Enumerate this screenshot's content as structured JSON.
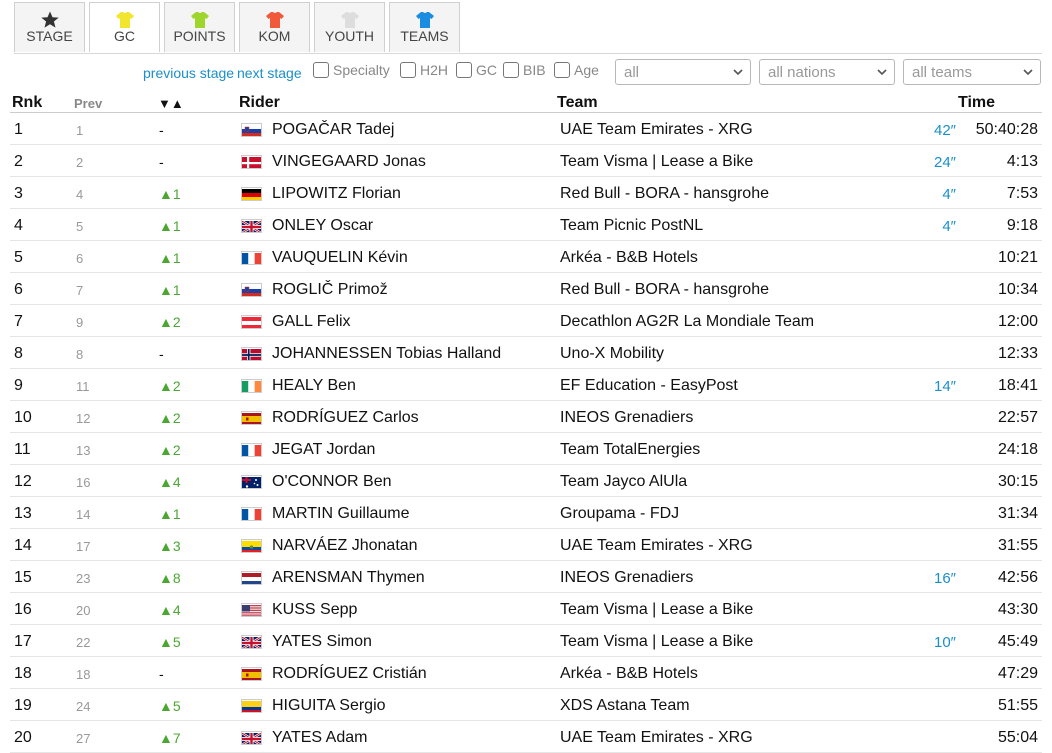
{
  "tabs": [
    {
      "label": "STAGE",
      "icon": "star-icon",
      "color": "#333333",
      "active": false
    },
    {
      "label": "GC",
      "icon": "jersey-icon",
      "color": "#f2e52e",
      "active": true
    },
    {
      "label": "POINTS",
      "icon": "jersey-icon",
      "color": "#9fd62c",
      "active": false
    },
    {
      "label": "KOM",
      "icon": "jersey-icon",
      "color": "#f05a3a",
      "active": false
    },
    {
      "label": "YOUTH",
      "icon": "jersey-icon",
      "color": "#dddddd",
      "active": false
    },
    {
      "label": "TEAMS",
      "icon": "jersey-icon",
      "color": "#1a8de0",
      "active": false
    }
  ],
  "filters": {
    "previous_stage": "previous stage",
    "next_stage": "next stage",
    "specialty": "Specialty",
    "h2h": "H2H",
    "gc": "GC",
    "bib": "BIB",
    "age": "Age",
    "select_all": "all",
    "select_nations": "all nations",
    "select_teams": "all teams"
  },
  "headers": {
    "rnk": "Rnk",
    "prev": "Prev",
    "change": "▼▲",
    "rider": "Rider",
    "team": "Team",
    "time": "Time"
  },
  "rows": [
    {
      "rnk": "1",
      "prev": "1",
      "chg": "-",
      "flag": "SI",
      "rider": "POGAČAR Tadej",
      "team": "UAE Team Emirates - XRG",
      "bonus": "42″",
      "time": "50:40:28"
    },
    {
      "rnk": "2",
      "prev": "2",
      "chg": "-",
      "flag": "DK",
      "rider": "VINGEGAARD Jonas",
      "team": "Team Visma | Lease a Bike",
      "bonus": "24″",
      "time": "4:13"
    },
    {
      "rnk": "3",
      "prev": "4",
      "chg": "▲1",
      "flag": "DE",
      "rider": "LIPOWITZ Florian",
      "team": "Red Bull - BORA - hansgrohe",
      "bonus": "4″",
      "time": "7:53"
    },
    {
      "rnk": "4",
      "prev": "5",
      "chg": "▲1",
      "flag": "GB",
      "rider": "ONLEY Oscar",
      "team": "Team Picnic PostNL",
      "bonus": "4″",
      "time": "9:18"
    },
    {
      "rnk": "5",
      "prev": "6",
      "chg": "▲1",
      "flag": "FR",
      "rider": "VAUQUELIN Kévin",
      "team": "Arkéa - B&B Hotels",
      "bonus": "",
      "time": "10:21"
    },
    {
      "rnk": "6",
      "prev": "7",
      "chg": "▲1",
      "flag": "SI",
      "rider": "ROGLIČ Primož",
      "team": "Red Bull - BORA - hansgrohe",
      "bonus": "",
      "time": "10:34"
    },
    {
      "rnk": "7",
      "prev": "9",
      "chg": "▲2",
      "flag": "AT",
      "rider": "GALL Felix",
      "team": "Decathlon AG2R La Mondiale Team",
      "bonus": "",
      "time": "12:00"
    },
    {
      "rnk": "8",
      "prev": "8",
      "chg": "-",
      "flag": "NO",
      "rider": "JOHANNESSEN Tobias Halland",
      "team": "Uno-X Mobility",
      "bonus": "",
      "time": "12:33"
    },
    {
      "rnk": "9",
      "prev": "11",
      "chg": "▲2",
      "flag": "IE",
      "rider": "HEALY Ben",
      "team": "EF Education - EasyPost",
      "bonus": "14″",
      "time": "18:41"
    },
    {
      "rnk": "10",
      "prev": "12",
      "chg": "▲2",
      "flag": "ES",
      "rider": "RODRÍGUEZ Carlos",
      "team": "INEOS Grenadiers",
      "bonus": "",
      "time": "22:57"
    },
    {
      "rnk": "11",
      "prev": "13",
      "chg": "▲2",
      "flag": "FR",
      "rider": "JEGAT Jordan",
      "team": "Team TotalEnergies",
      "bonus": "",
      "time": "24:18"
    },
    {
      "rnk": "12",
      "prev": "16",
      "chg": "▲4",
      "flag": "AU",
      "rider": "O'CONNOR Ben",
      "team": "Team Jayco AlUla",
      "bonus": "",
      "time": "30:15"
    },
    {
      "rnk": "13",
      "prev": "14",
      "chg": "▲1",
      "flag": "FR",
      "rider": "MARTIN Guillaume",
      "team": "Groupama - FDJ",
      "bonus": "",
      "time": "31:34"
    },
    {
      "rnk": "14",
      "prev": "17",
      "chg": "▲3",
      "flag": "EC",
      "rider": "NARVÁEZ Jhonatan",
      "team": "UAE Team Emirates - XRG",
      "bonus": "",
      "time": "31:55"
    },
    {
      "rnk": "15",
      "prev": "23",
      "chg": "▲8",
      "flag": "NL",
      "rider": "ARENSMAN Thymen",
      "team": "INEOS Grenadiers",
      "bonus": "16″",
      "time": "42:56"
    },
    {
      "rnk": "16",
      "prev": "20",
      "chg": "▲4",
      "flag": "US",
      "rider": "KUSS Sepp",
      "team": "Team Visma | Lease a Bike",
      "bonus": "",
      "time": "43:30"
    },
    {
      "rnk": "17",
      "prev": "22",
      "chg": "▲5",
      "flag": "GB",
      "rider": "YATES Simon",
      "team": "Team Visma | Lease a Bike",
      "bonus": "10″",
      "time": "45:49"
    },
    {
      "rnk": "18",
      "prev": "18",
      "chg": "-",
      "flag": "ES",
      "rider": "RODRÍGUEZ Cristián",
      "team": "Arkéa - B&B Hotels",
      "bonus": "",
      "time": "47:29"
    },
    {
      "rnk": "19",
      "prev": "24",
      "chg": "▲5",
      "flag": "CO",
      "rider": "HIGUITA Sergio",
      "team": "XDS Astana Team",
      "bonus": "",
      "time": "51:55"
    },
    {
      "rnk": "20",
      "prev": "27",
      "chg": "▲7",
      "flag": "GB",
      "rider": "YATES Adam",
      "team": "UAE Team Emirates - XRG",
      "bonus": "",
      "time": "55:04"
    }
  ],
  "colors": {
    "link": "#1a8fc9",
    "up": "#4aa832"
  }
}
